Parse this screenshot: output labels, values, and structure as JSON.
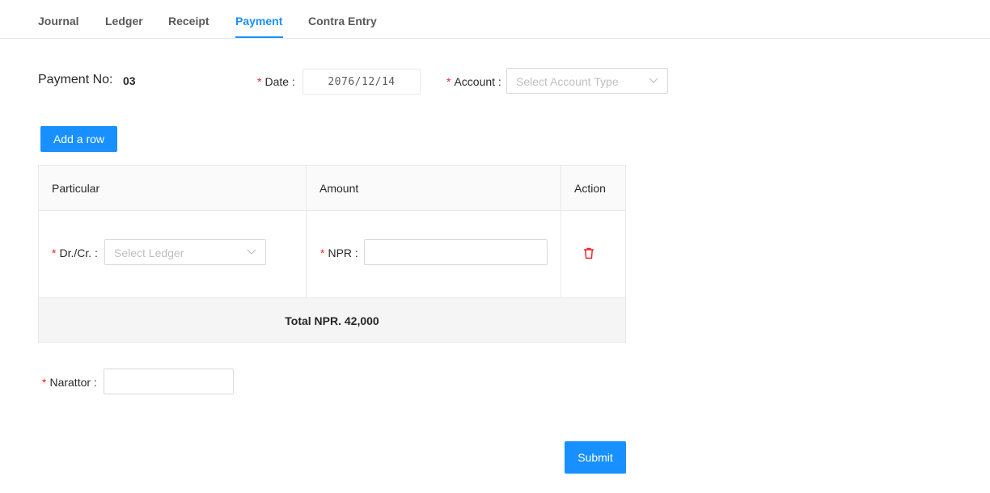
{
  "tabs": [
    {
      "label": "Journal",
      "active": false
    },
    {
      "label": "Ledger",
      "active": false
    },
    {
      "label": "Receipt",
      "active": false
    },
    {
      "label": "Payment",
      "active": true
    },
    {
      "label": "Contra Entry",
      "active": false
    }
  ],
  "header": {
    "payment_no_label": "Payment No:",
    "payment_no_value": "03",
    "date_label": "Date",
    "date_value": "2076/12/14",
    "account_label": "Account",
    "account_placeholder": "Select Account Type"
  },
  "add_row_label": "Add a row",
  "table": {
    "columns": [
      "Particular",
      "Amount",
      "Action"
    ],
    "rows": [
      {
        "drcr_label": "Dr./Cr.",
        "ledger_placeholder": "Select Ledger",
        "npr_label": "NPR",
        "npr_value": ""
      }
    ],
    "total_label": "Total NPR. 42,000"
  },
  "narrator": {
    "label": "Narattor",
    "value": ""
  },
  "submit_label": "Submit",
  "colors": {
    "primary": "#1890ff",
    "required": "#f5222d",
    "danger": "#f5222d"
  },
  "icons": {
    "chevron": "chevron-down-icon",
    "delete": "delete-icon"
  }
}
